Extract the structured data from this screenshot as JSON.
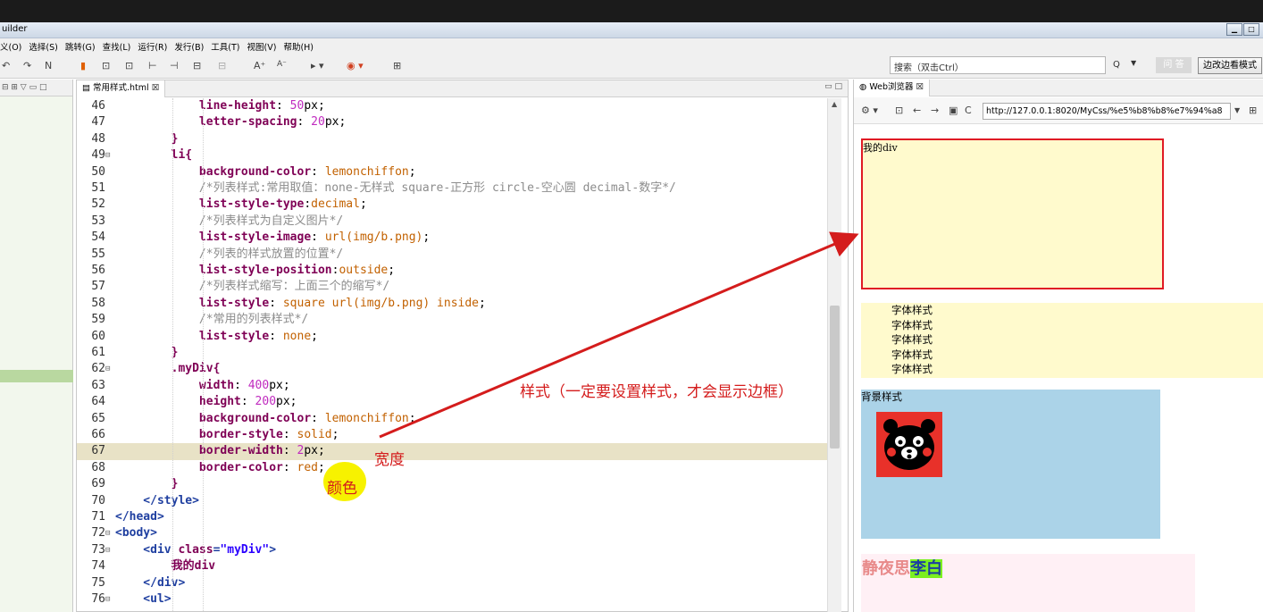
{
  "window": {
    "title": "uilder"
  },
  "menu": [
    {
      "label": "义(O)"
    },
    {
      "label": "选择(S)"
    },
    {
      "label": "跳转(G)"
    },
    {
      "label": "查找(L)"
    },
    {
      "label": "运行(R)"
    },
    {
      "label": "发行(B)"
    },
    {
      "label": "工具(T)"
    },
    {
      "label": "视图(V)"
    },
    {
      "label": "帮助(H)"
    }
  ],
  "search": {
    "placeholder": "搜索（双击Ctrl）",
    "ask_label": "问 答",
    "mode_label": "边改边看模式"
  },
  "editor": {
    "tab_label": "常用样式.html",
    "lines": [
      {
        "n": "46",
        "fold": "",
        "text": "            line-height: 50px;"
      },
      {
        "n": "47",
        "fold": "",
        "text": "            letter-spacing: 20px;"
      },
      {
        "n": "48",
        "fold": "",
        "text": "        }"
      },
      {
        "n": "49",
        "fold": "⊟",
        "text": "        li{"
      },
      {
        "n": "50",
        "fold": "",
        "text": "            background-color: lemonchiffon;"
      },
      {
        "n": "51",
        "fold": "",
        "text": "            /*列表样式:常用取值：none-无样式 square-正方形 circle-空心圆 decimal-数字*/"
      },
      {
        "n": "52",
        "fold": "",
        "text": "            list-style-type:decimal;"
      },
      {
        "n": "53",
        "fold": "",
        "text": "            /*列表样式为自定义图片*/"
      },
      {
        "n": "54",
        "fold": "",
        "text": "            list-style-image: url(img/b.png);"
      },
      {
        "n": "55",
        "fold": "",
        "text": "            /*列表的样式放置的位置*/"
      },
      {
        "n": "56",
        "fold": "",
        "text": "            list-style-position:outside;"
      },
      {
        "n": "57",
        "fold": "",
        "text": "            /*列表样式缩写：上面三个的缩写*/"
      },
      {
        "n": "58",
        "fold": "",
        "text": "            list-style: square url(img/b.png) inside;"
      },
      {
        "n": "59",
        "fold": "",
        "text": "            /*常用的列表样式*/"
      },
      {
        "n": "60",
        "fold": "",
        "text": "            list-style: none;"
      },
      {
        "n": "61",
        "fold": "",
        "text": "        }"
      },
      {
        "n": "62",
        "fold": "⊟",
        "text": "        .myDiv{"
      },
      {
        "n": "63",
        "fold": "",
        "text": "            width: 400px;"
      },
      {
        "n": "64",
        "fold": "",
        "text": "            height: 200px;"
      },
      {
        "n": "65",
        "fold": "",
        "text": "            background-color: lemonchiffon;"
      },
      {
        "n": "66",
        "fold": "",
        "text": "            border-style: solid;"
      },
      {
        "n": "67",
        "fold": "",
        "text": "            border-width: 2px;"
      },
      {
        "n": "68",
        "fold": "",
        "text": "            border-color: red;"
      },
      {
        "n": "69",
        "fold": "",
        "text": "        }"
      },
      {
        "n": "70",
        "fold": "",
        "text": "    </style>"
      },
      {
        "n": "71",
        "fold": "",
        "text": "</head>"
      },
      {
        "n": "72",
        "fold": "⊟",
        "text": "<body>"
      },
      {
        "n": "73",
        "fold": "⊟",
        "text": "    <div class=\"myDiv\">"
      },
      {
        "n": "74",
        "fold": "",
        "text": "        我的div"
      },
      {
        "n": "75",
        "fold": "",
        "text": "    </div>"
      },
      {
        "n": "76",
        "fold": "⊟",
        "text": "    <ul>"
      }
    ],
    "current_line": "67"
  },
  "browser": {
    "tab_label": "Web浏览器",
    "url": "http://127.0.0.1:8020/MyCss/%e5%b8%b8%e7%94%a8",
    "mydiv_text": "我的div",
    "list_items": [
      "字体样式",
      "字体样式",
      "字体样式",
      "字体样式",
      "字体样式"
    ],
    "bg_text": "背景样式",
    "poem_title": "静夜思",
    "poem_author": "李白"
  },
  "annotations": {
    "style_note": "样式（一定要设置样式，才会显示边框）",
    "width_note": "宽度",
    "color_note": "颜色"
  },
  "colors": {
    "keyword": "#7f0055",
    "value": "#c26100",
    "number": "#c02bbf",
    "comment": "#8c8c8c",
    "tag": "#1f3fa0",
    "annotation": "#d41c1c"
  }
}
